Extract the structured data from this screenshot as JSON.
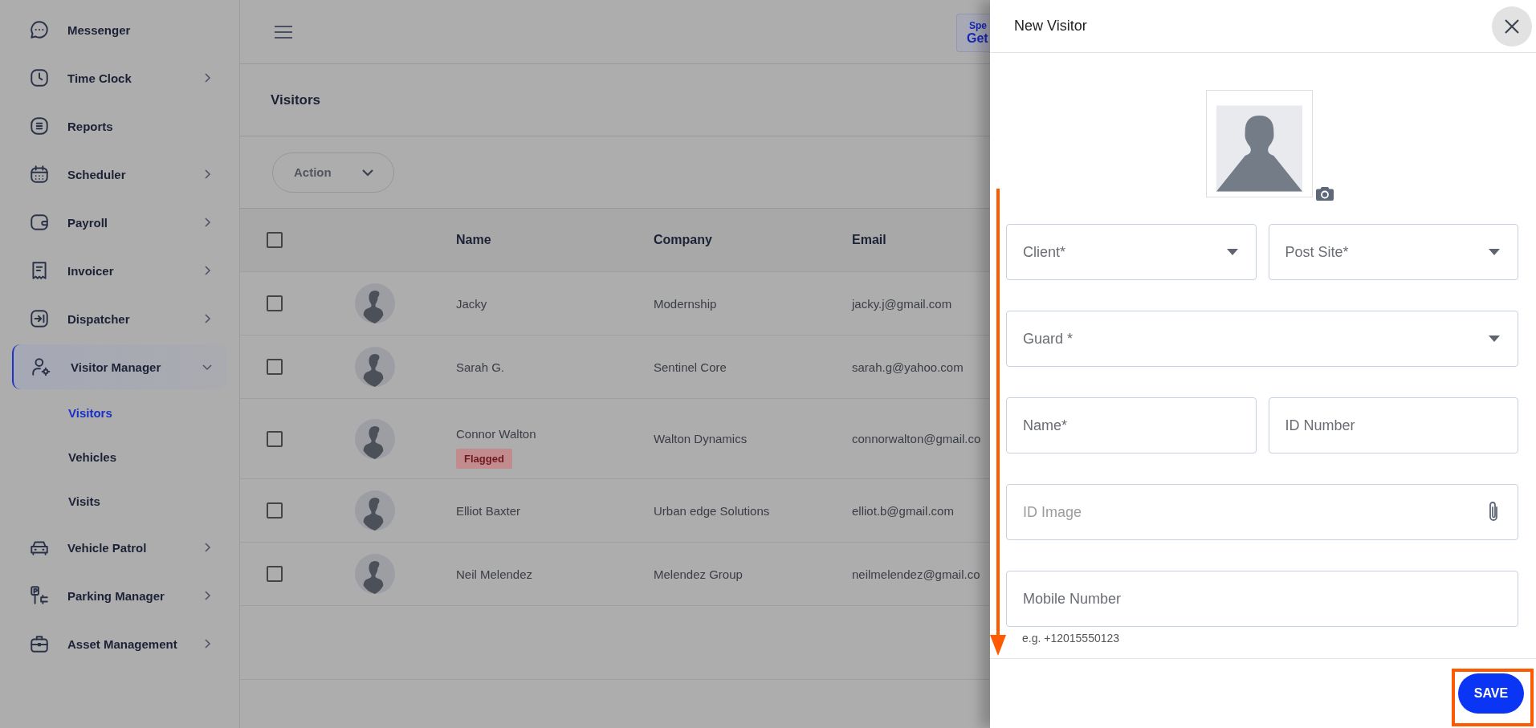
{
  "sidebar": {
    "items": [
      {
        "label": "Messenger",
        "kind": "link",
        "selected": false
      },
      {
        "label": "Time Clock",
        "kind": "group",
        "expanded": false,
        "selected": false
      },
      {
        "label": "Reports",
        "kind": "link",
        "selected": false
      },
      {
        "label": "Scheduler",
        "kind": "group",
        "expanded": false,
        "selected": false
      },
      {
        "label": "Payroll",
        "kind": "group",
        "expanded": false,
        "selected": false
      },
      {
        "label": "Invoicer",
        "kind": "group",
        "expanded": false,
        "selected": false
      },
      {
        "label": "Dispatcher",
        "kind": "group",
        "expanded": false,
        "selected": false
      },
      {
        "label": "Visitor Manager",
        "kind": "group",
        "expanded": true,
        "selected": true,
        "children": [
          {
            "label": "Visitors",
            "selected": true
          },
          {
            "label": "Vehicles",
            "selected": false
          },
          {
            "label": "Visits",
            "selected": false
          }
        ]
      },
      {
        "label": "Vehicle Patrol",
        "kind": "group",
        "expanded": false,
        "selected": false
      },
      {
        "label": "Parking Manager",
        "kind": "group",
        "expanded": false,
        "selected": false
      },
      {
        "label": "Asset Management",
        "kind": "group",
        "expanded": false,
        "selected": false
      }
    ]
  },
  "top_bar": {
    "promo_button": {
      "lines": [
        "Spe",
        "Get"
      ]
    }
  },
  "page_title": "Visitors",
  "action_button": "Action",
  "table": {
    "header_checked": false,
    "columns": [
      "Name",
      "Company",
      "Email"
    ],
    "rows": [
      {
        "checked": false,
        "name": "Jacky",
        "company": "Modernship",
        "email": "jacky.j@gmail.com"
      },
      {
        "checked": false,
        "name": "Sarah G.",
        "company": "Sentinel Core",
        "email": "sarah.g@yahoo.com"
      },
      {
        "checked": false,
        "name": "Connor Walton",
        "tag": "Flagged",
        "company": "Walton Dynamics",
        "email": "connorwalton@gmail.co"
      },
      {
        "checked": false,
        "name": "Elliot Baxter",
        "company": "Urban edge Solutions",
        "email": "elliot.b@gmail.com"
      },
      {
        "checked": false,
        "name": "Neil Melendez",
        "company": "Melendez Group",
        "email": "neilmelendez@gmail.co"
      }
    ]
  },
  "panel": {
    "title": "New Visitor",
    "fields": [
      [
        {
          "kind": "select",
          "placeholder": "Client*"
        },
        {
          "kind": "select",
          "placeholder": "Post Site*"
        }
      ],
      [
        {
          "kind": "select",
          "placeholder": "Guard *"
        }
      ],
      [
        {
          "kind": "text",
          "placeholder": "Name*"
        },
        {
          "kind": "text",
          "placeholder": "ID Number"
        }
      ],
      [
        {
          "kind": "file",
          "placeholder": "ID Image"
        }
      ],
      [
        {
          "kind": "text",
          "placeholder": "Mobile Number",
          "hint": "e.g. +12015550123"
        }
      ]
    ],
    "save_button": "SAVE"
  }
}
